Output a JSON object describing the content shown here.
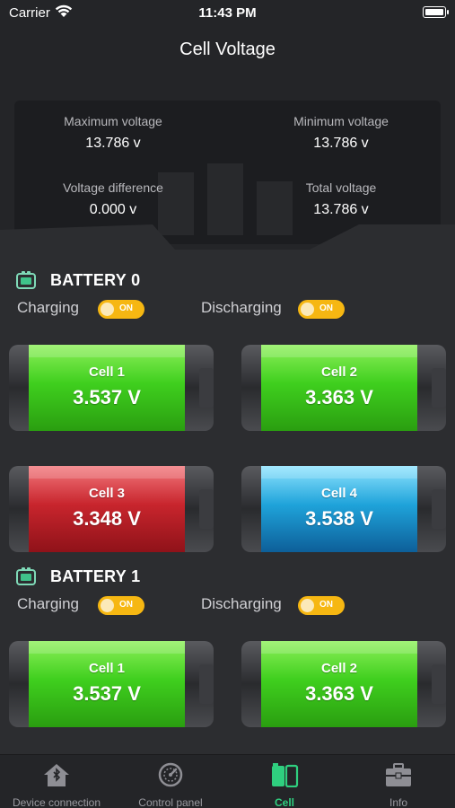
{
  "status_bar": {
    "carrier": "Carrier",
    "time": "11:43 PM"
  },
  "page": {
    "title": "Cell Voltage"
  },
  "summary": {
    "max_label": "Maximum voltage",
    "max_value": "13.786 v",
    "min_label": "Minimum voltage",
    "min_value": "13.786 v",
    "diff_label": "Voltage difference",
    "diff_value": "0.000 v",
    "total_label": "Total voltage",
    "total_value": "13.786 v"
  },
  "batteries": [
    {
      "name": "BATTERY 0",
      "charging_label": "Charging",
      "charging_state": "ON",
      "discharging_label": "Discharging",
      "discharging_state": "ON",
      "cells": [
        {
          "name": "Cell 1",
          "voltage": "3.537 V",
          "color": "green"
        },
        {
          "name": "Cell 2",
          "voltage": "3.363 V",
          "color": "green"
        },
        {
          "name": "Cell 3",
          "voltage": "3.348 V",
          "color": "red"
        },
        {
          "name": "Cell 4",
          "voltage": "3.538 V",
          "color": "blue"
        }
      ]
    },
    {
      "name": "BATTERY 1",
      "charging_label": "Charging",
      "charging_state": "ON",
      "discharging_label": "Discharging",
      "discharging_state": "ON",
      "cells": [
        {
          "name": "Cell 1",
          "voltage": "3.537 V",
          "color": "green"
        },
        {
          "name": "Cell 2",
          "voltage": "3.363 V",
          "color": "green"
        }
      ]
    }
  ],
  "tabs": [
    {
      "label": "Device connection",
      "icon": "home-bluetooth-icon",
      "active": false
    },
    {
      "label": "Control panel",
      "icon": "gauge-icon",
      "active": false
    },
    {
      "label": "Cell",
      "icon": "battery-cell-icon",
      "active": true
    },
    {
      "label": "Info",
      "icon": "briefcase-icon",
      "active": false
    }
  ],
  "colors": {
    "toggle_on": "#f6b712",
    "tab_active": "#2fcf7f",
    "cell_green": "#3fcf1e",
    "cell_red": "#c8252d",
    "cell_blue": "#1fa3da"
  }
}
